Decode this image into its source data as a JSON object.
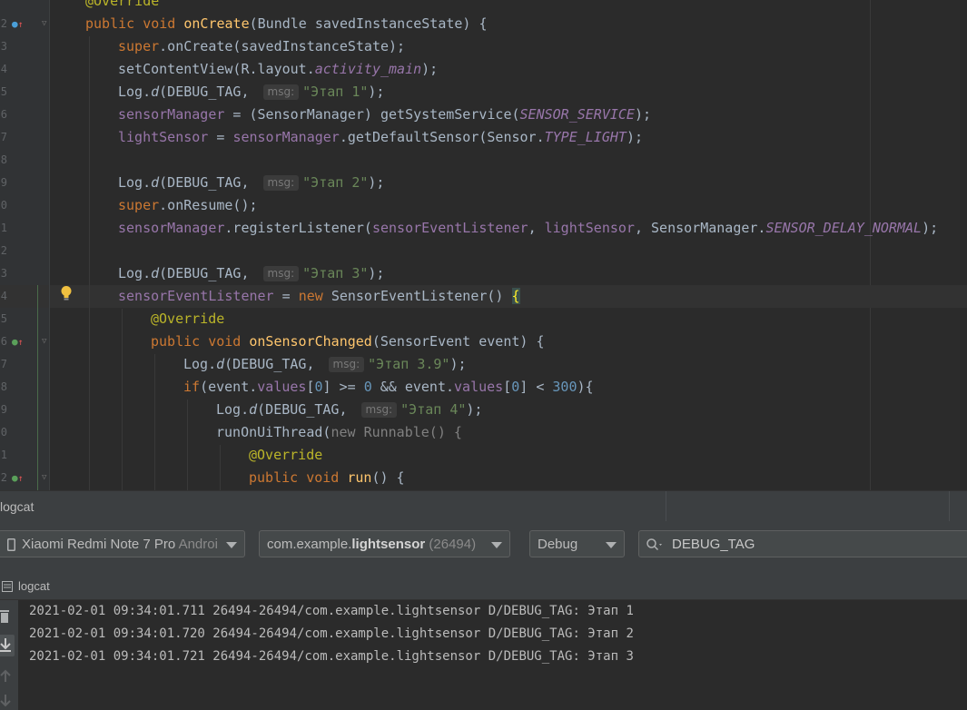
{
  "editor": {
    "line_numbers": [
      "2",
      "3",
      "4",
      "5",
      "6",
      "7",
      "8",
      "9",
      "0",
      "1",
      "2",
      "3",
      "4",
      "5",
      "6",
      "7",
      "8",
      "9",
      "0",
      "1",
      "2"
    ],
    "lines": {
      "l0": {
        "a": "@Override"
      },
      "l1": {
        "a": "public void ",
        "b": "onCreate",
        "c": "(Bundle savedInstanceState) {"
      },
      "l2": {
        "a": "super",
        "b": ".onCreate(savedInstanceState);"
      },
      "l3": {
        "a": "setContentView(R.layout.",
        "b": "activity_main",
        "c": ");"
      },
      "l4": {
        "a": "Log.",
        "b": "d",
        "c": "(DEBUG_TAG, ",
        "hint": "msg:",
        "s": "\"Этап 1\"",
        "e": ");"
      },
      "l5": {
        "a": "sensorManager",
        "b": " = (SensorManager) getSystemService(",
        "c": "SENSOR_SERVICE",
        "d": ");"
      },
      "l6": {
        "a": "lightSensor",
        "b": " = ",
        "c": "sensorManager",
        "d": ".getDefaultSensor(Sensor.",
        "e": "TYPE_LIGHT",
        "f": ");"
      },
      "l8": {
        "a": "Log.",
        "b": "d",
        "c": "(DEBUG_TAG, ",
        "hint": "msg:",
        "s": "\"Этап 2\"",
        "e": ");"
      },
      "l9": {
        "a": "super",
        "b": ".onResume();"
      },
      "l10": {
        "a": "sensorManager",
        "b": ".registerListener(",
        "c": "sensorEventListener",
        "d": ", ",
        "e": "lightSensor",
        "f": ", SensorManager.",
        "g": "SENSOR_DELAY_NORMAL",
        "h": ");"
      },
      "l12": {
        "a": "Log.",
        "b": "d",
        "c": "(DEBUG_TAG, ",
        "hint": "msg:",
        "s": "\"Этап 3\"",
        "e": ");"
      },
      "l13": {
        "a": "sensorEventListener",
        "b": " = ",
        "c": "new ",
        "d": "SensorEventListener() ",
        "e": "{"
      },
      "l14": {
        "a": "@Override"
      },
      "l15": {
        "a": "public void ",
        "b": "onSensorChanged",
        "c": "(SensorEvent event) {"
      },
      "l16": {
        "a": "Log.",
        "b": "d",
        "c": "(DEBUG_TAG, ",
        "hint": "msg:",
        "s": "\"Этап 3.9\"",
        "e": ");"
      },
      "l17": {
        "a": "if",
        "b": "(event.",
        "c": "values",
        "d": "[",
        "n1": "0",
        "e": "] >= ",
        "n2": "0",
        "f": " && event.",
        "g": "values",
        "h": "[",
        "n3": "0",
        "i": "] < ",
        "n4": "300",
        "j": "){"
      },
      "l18": {
        "a": "Log.",
        "b": "d",
        "c": "(DEBUG_TAG, ",
        "hint": "msg:",
        "s": "\"Этап 4\"",
        "e": ");"
      },
      "l19": {
        "a": "runOnUiThread(",
        "b": "new ",
        "c": "Runnable() {"
      },
      "l20": {
        "a": "@Override"
      },
      "l21": {
        "a": "public void ",
        "b": "run",
        "c": "() {"
      }
    }
  },
  "logcat": {
    "title": "logcat",
    "device": {
      "name": "Xiaomi Redmi Note 7 Pro ",
      "suffix": "Androi"
    },
    "process": {
      "prefix": "com.example.",
      "bold": "lightsensor",
      "pid": " (26494)"
    },
    "level": "Debug",
    "search": {
      "value": "DEBUG_TAG"
    },
    "subheader": "logcat",
    "entries": [
      "2021-02-01 09:34:01.711 26494-26494/com.example.lightsensor D/DEBUG_TAG: Этап 1",
      "2021-02-01 09:34:01.720 26494-26494/com.example.lightsensor D/DEBUG_TAG: Этап 2",
      "2021-02-01 09:34:01.721 26494-26494/com.example.lightsensor D/DEBUG_TAG: Этап 3"
    ]
  },
  "icons": [
    "override-up-icon",
    "implement-up-icon",
    "lightbulb-icon",
    "fold-icon",
    "phone-icon",
    "search-icon",
    "trash-icon",
    "scroll-to-end-icon",
    "up-arrow-icon",
    "down-arrow-icon"
  ],
  "colors": {
    "keyword": "#cc7832",
    "function": "#ffc66d",
    "field": "#9876aa",
    "annotation": "#bbb529",
    "string": "#6a8759",
    "number": "#6897bb"
  }
}
